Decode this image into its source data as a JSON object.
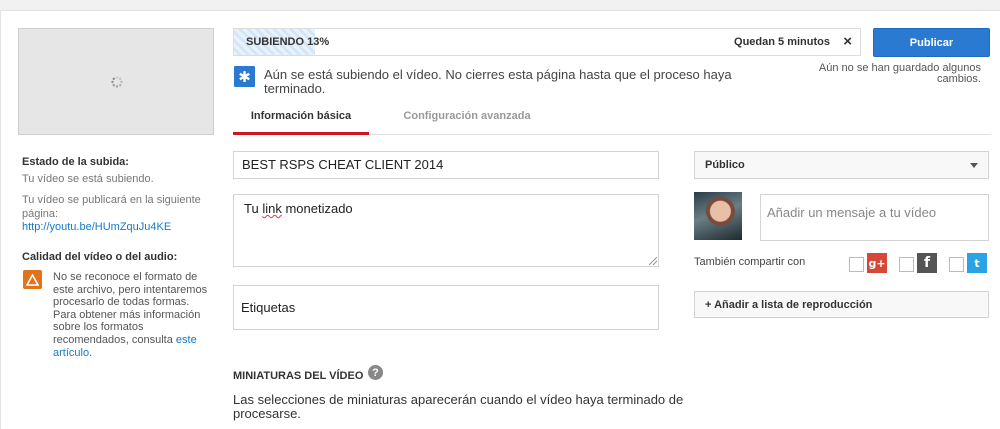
{
  "upload": {
    "progress_label": "SUBIENDO 13%",
    "progress_fraction": 0.13,
    "time_left": "Quedan 5 minutos",
    "close_glyph": "×"
  },
  "publish": {
    "button_label": "Publicar",
    "not_saved": "Aún no se han guardado algunos cambios."
  },
  "notice": {
    "icon": "✱",
    "text": "Aún se está subiendo el vídeo. No cierres esta página hasta que el proceso haya terminado."
  },
  "sidebar": {
    "status_heading": "Estado de la subida:",
    "status_line": "Tu vídeo se está subiendo.",
    "publish_line": "Tu vídeo se publicará en la siguiente página:",
    "video_url": "http://youtu.be/HUmZquJu4KE",
    "quality_heading": "Calidad del vídeo o del audio:",
    "quality_text": "No se reconoce el formato de este archivo, pero intentaremos procesarlo de todas formas. Para obtener más información sobre los formatos recomendados, consulta ",
    "quality_link": "este artículo",
    "quality_end": "."
  },
  "tabs": [
    {
      "label": "Información básica",
      "active": true
    },
    {
      "label": "Configuración avanzada",
      "active": false
    }
  ],
  "form": {
    "title_value": "BEST RSPS CHEAT CLIENT 2014",
    "desc_before": "Tu ",
    "desc_misspelled": "link",
    "desc_after": " monetizado",
    "tags_placeholder": "Etiquetas"
  },
  "thumbnails": {
    "heading": "MINIATURAS DEL VÍDEO",
    "help_glyph": "?",
    "text": "Las selecciones de miniaturas aparecerán cuando el vídeo haya terminado de procesarse."
  },
  "right": {
    "privacy_value": "Público",
    "message_placeholder": "Añadir un mensaje a tu vídeo",
    "share_label": "También compartir con",
    "gplus_glyph": "g+",
    "facebook_glyph": "f",
    "twitter_glyph": "t",
    "add_to_playlist": "+ Añadir a lista de reproducción"
  },
  "colors": {
    "accent_blue": "#2a7ad1",
    "tab_active_red": "#cc181e",
    "warning_orange": "#e1731b",
    "link_blue": "#167ac6"
  }
}
